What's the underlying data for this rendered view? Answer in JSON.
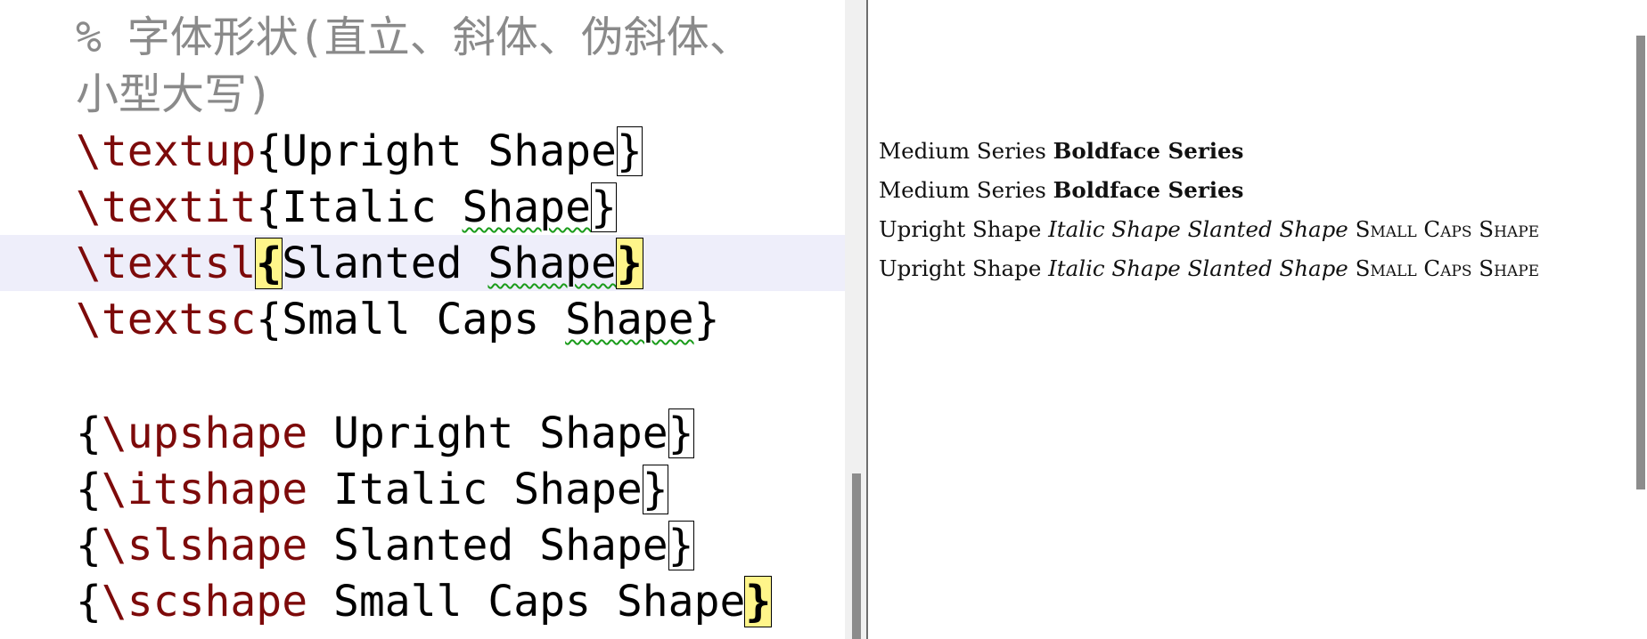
{
  "editor": {
    "comment_line1": "% 字体形状(直立、斜体、伪斜体、",
    "comment_line2": "小型大写)",
    "lines": [
      {
        "cmd": "\\textup",
        "open": "{",
        "text": "Upright Shape",
        "close": "}"
      },
      {
        "cmd": "\\textit",
        "open": "{",
        "text_pre": "Italic ",
        "text_spell": "Shape",
        "close": "}"
      },
      {
        "cmd": "\\textsl",
        "open": "{",
        "text_pre": "Slanted ",
        "text_spell": "Shape",
        "close": "}"
      },
      {
        "cmd": "\\textsc",
        "open": "{",
        "text_pre": "Small Caps ",
        "text_spell": "Shape",
        "close": "}"
      }
    ],
    "group_lines": [
      {
        "open": "{",
        "cmd": "\\upshape",
        "text": " Upright Shape",
        "close": "}"
      },
      {
        "open": "{",
        "cmd": "\\itshape",
        "text": " Italic Shape",
        "close": "}"
      },
      {
        "open": "{",
        "cmd": "\\slshape",
        "text": " Slanted Shape",
        "close": "}"
      },
      {
        "open": "{",
        "cmd": "\\scshape",
        "text": " Small Caps Shape",
        "close": "}"
      }
    ]
  },
  "preview": {
    "row1": {
      "medium": "Medium Series",
      "bold": "Boldface Series"
    },
    "row2": {
      "medium": "Medium Series",
      "bold": "Boldface Series"
    },
    "row3": {
      "upright": "Upright Shape",
      "italic": "Italic Shape",
      "slanted": "Slanted Shape",
      "smallcaps": "Small Caps Shape"
    },
    "row4": {
      "upright": "Upright Shape",
      "italic": "Italic Shape",
      "slanted": "Slanted Shape",
      "smallcaps": "Small Caps Shape"
    }
  },
  "colors": {
    "command": "#7d0a0a",
    "comment": "#8a8a8a",
    "current_line": "#eeeefa",
    "brace_match": "#fff58a",
    "spell_underline": "#1a9b1a"
  }
}
